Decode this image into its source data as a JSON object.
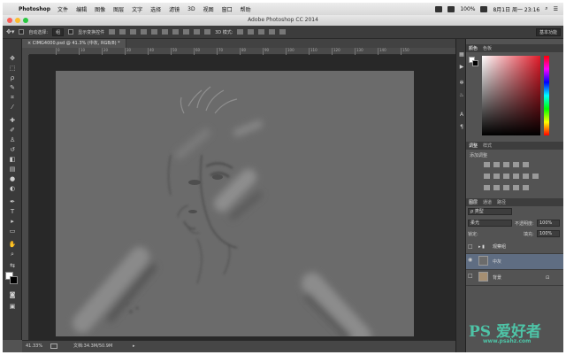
{
  "menubar": {
    "app_name": "Photoshop",
    "items": [
      "文件",
      "编辑",
      "图像",
      "图层",
      "文字",
      "选择",
      "滤镜",
      "3D",
      "视图",
      "窗口",
      "帮助"
    ],
    "battery": "100%",
    "datetime": "8月1日 周一  23:16"
  },
  "window": {
    "title": "Adobe Photoshop CC 2014"
  },
  "options": {
    "auto_select_label": "自动选择:",
    "auto_select_value": "组",
    "show_transform_label": "显示变换控件",
    "mode_3d_label": "3D 模式:",
    "workspace": "基本功能"
  },
  "document": {
    "tab_label": "CIMG4000.psd @ 41.3% (中灰, RGB/8) *"
  },
  "rulers": {
    "top": [
      "0",
      "10",
      "20",
      "30",
      "40",
      "50",
      "60",
      "70",
      "80",
      "90",
      "100",
      "110",
      "120",
      "130",
      "140",
      "150"
    ]
  },
  "status": {
    "zoom": "41.33%",
    "doc_info": "文档:34.3M/50.9M"
  },
  "panels": {
    "color_tabs": [
      "颜色",
      "色板"
    ],
    "adjust_tabs": [
      "调整",
      "样式"
    ],
    "adjust_title": "添加调整",
    "layers_tabs": [
      "图层",
      "通道",
      "路径"
    ],
    "filter_kind": "ρ 类型",
    "blend_mode": "柔光",
    "opacity_label": "不透明度:",
    "opacity_value": "100%",
    "lock_label": "锁定:",
    "fill_label": "填充:",
    "fill_value": "100%",
    "layers": [
      {
        "name": "观察组"
      },
      {
        "name": "中灰"
      },
      {
        "name": "背景"
      }
    ]
  },
  "watermark": {
    "brand": "PS 爱好者",
    "url": "www.psahz.com"
  },
  "colors": {
    "fg": "#ffffff",
    "bg": "#000000",
    "accent": "#e11c2a"
  }
}
